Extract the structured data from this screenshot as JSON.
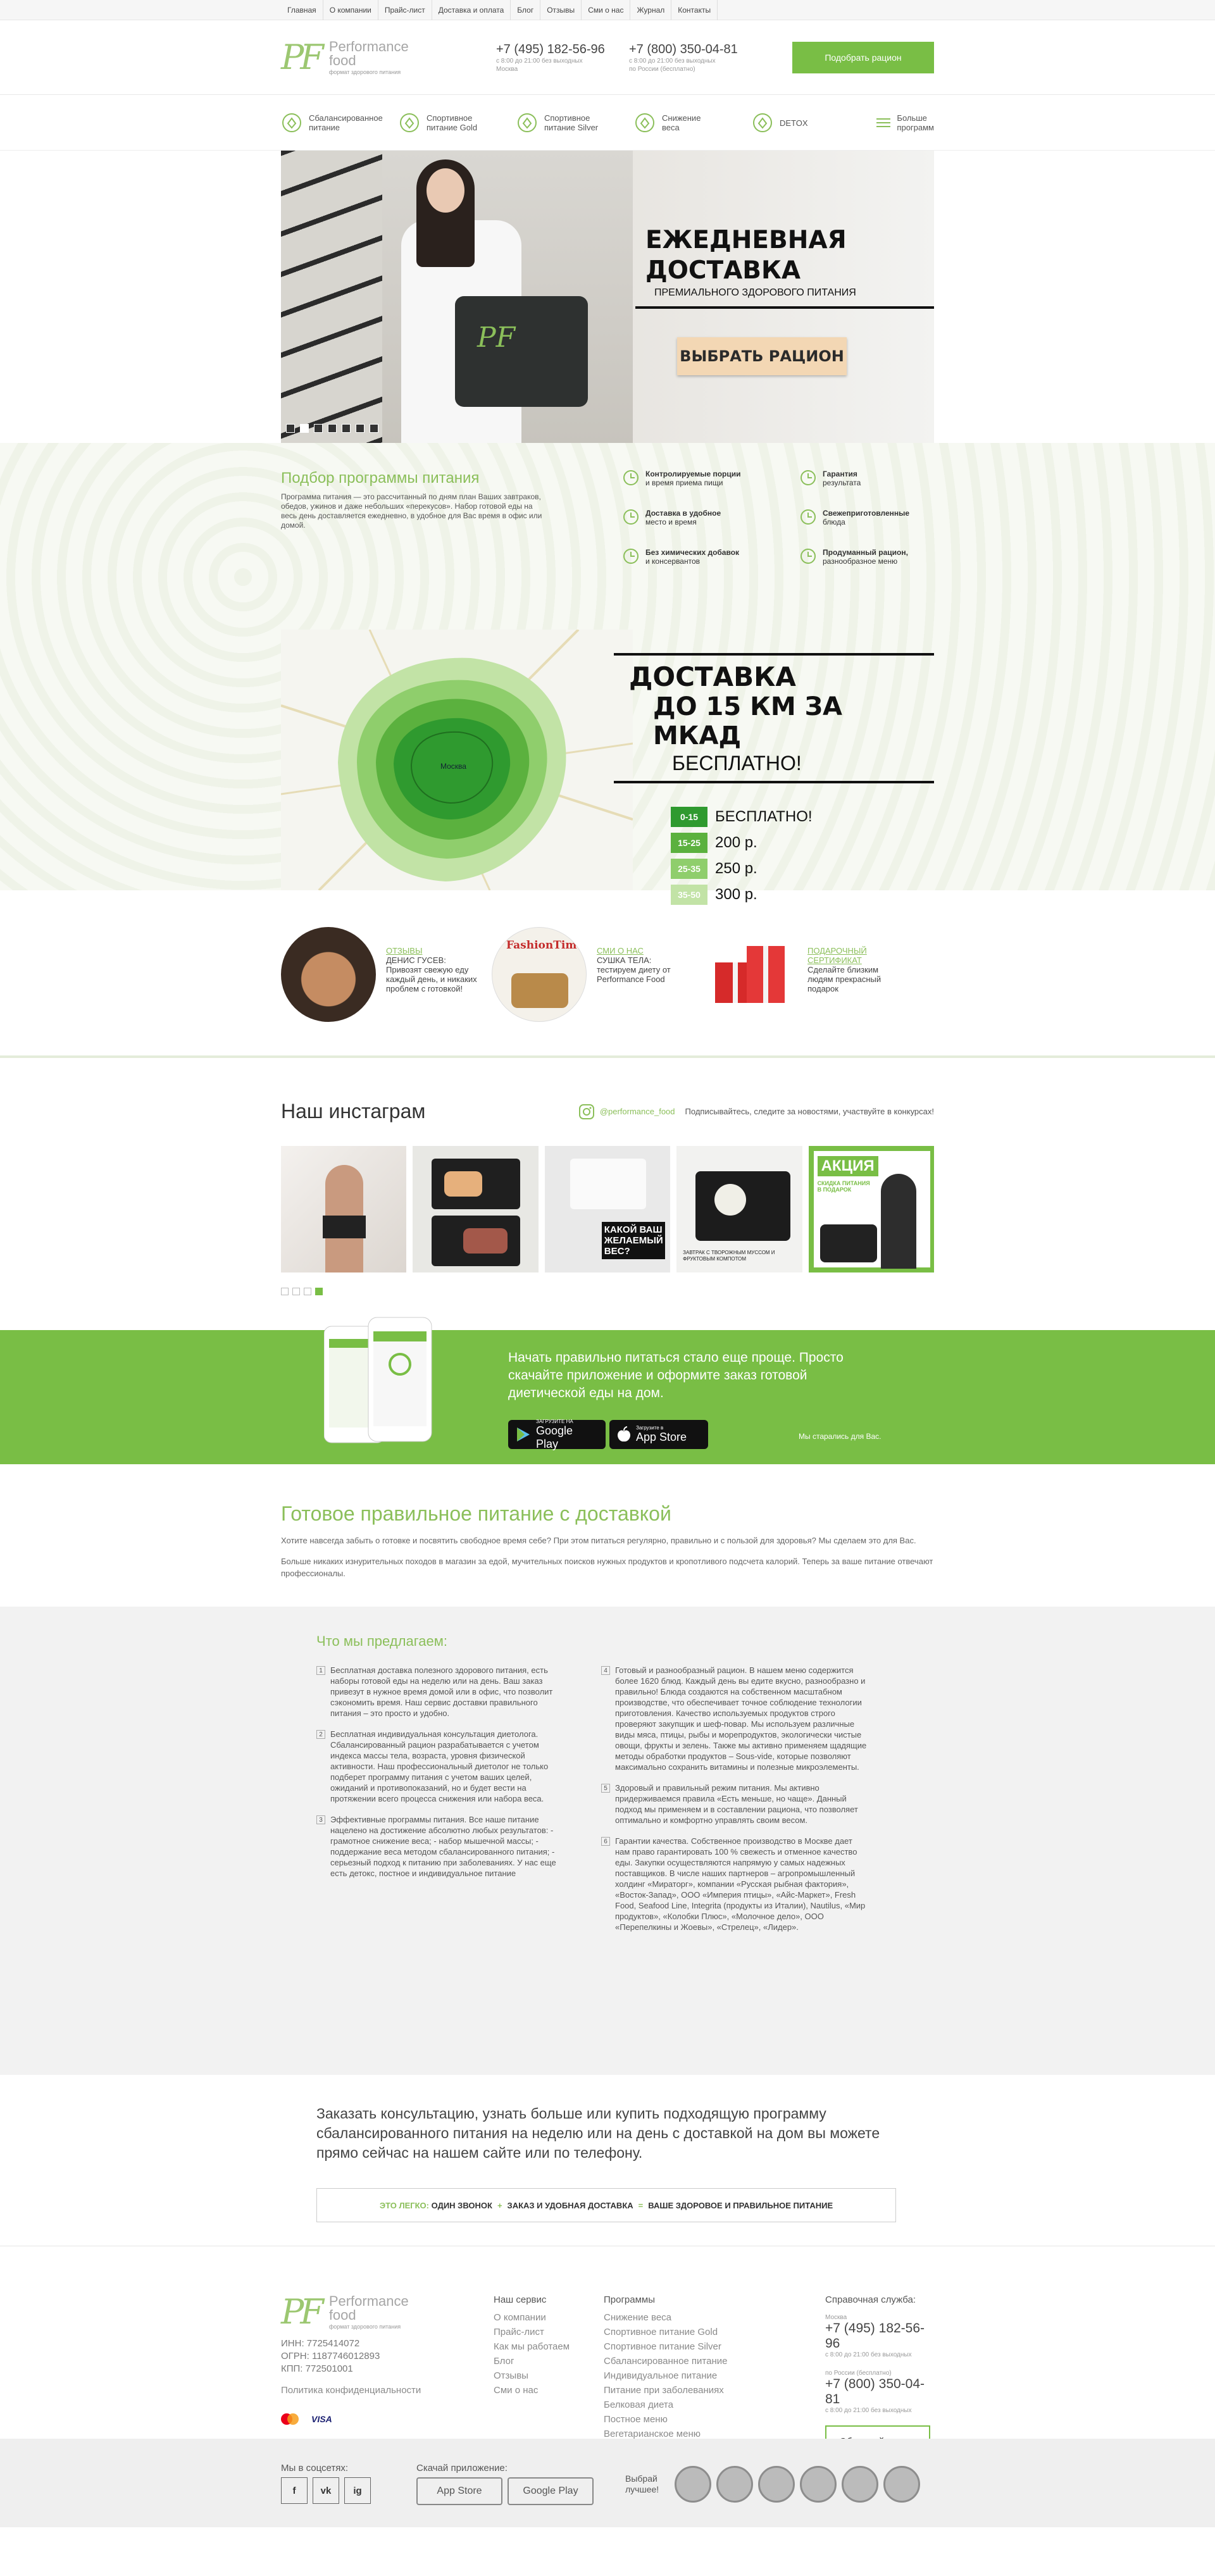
{
  "topnav": [
    "Главная",
    "О компании",
    "Прайс-лист",
    "Доставка и оплата",
    "Блог",
    "Отзывы",
    "Сми о нас",
    "Журнал",
    "Контакты"
  ],
  "header": {
    "logo_mark": "PF",
    "logo_l1": "Performance",
    "logo_l2": "food",
    "logo_sub": "формат здорового питания",
    "phone1": "+7 (495) 182-56-96",
    "phone1_sub1": "с 8:00 до 21:00 без выходных",
    "phone1_sub2": "Москва",
    "phone2": "+7 (800) 350-04-81",
    "phone2_sub1": "с 8:00 до 21:00 без выходных",
    "phone2_sub2": "по России (бесплатно)",
    "cta": "Подобрать рацион"
  },
  "programs": [
    {
      "label1": "Сбалансированное",
      "label2": "питание",
      "icon": "apple-icon"
    },
    {
      "label1": "Спортивное",
      "label2": "питание Gold",
      "icon": "runner-icon"
    },
    {
      "label1": "Спортивное",
      "label2": "питание Silver",
      "icon": "runner-icon"
    },
    {
      "label1": "Снижение",
      "label2": "веса",
      "icon": "scale-icon"
    },
    {
      "label1": "DETOX",
      "label2": "",
      "icon": "glass-icon"
    }
  ],
  "programs_more": {
    "l1": "Больше",
    "l2": "программ"
  },
  "hero": {
    "title1": "ЕЖЕДНЕВНАЯ",
    "title2": "ДОСТАВКА",
    "subtitle": "ПРЕМИАЛЬНОГО ЗДОРОВОГО ПИТАНИЯ",
    "button": "ВЫБРАТЬ РАЦИОН",
    "slide_count": 7,
    "active_slide": 2
  },
  "selection": {
    "title": "Подбор программы питания",
    "desc": "Программа питания — это рассчитанный по дням план Ваших завтраков, обедов, ужинов и даже небольших «перекусов». Набор готовой еды на весь день доставляется ежедневно, в удобное для Вас время в офис или домой.",
    "features": [
      {
        "b": "Контролируемые порции",
        "t": "и время приема пищи"
      },
      {
        "b": "Гарантия",
        "t": "результата"
      },
      {
        "b": "Доставка в удобное",
        "t": "место и время"
      },
      {
        "b": "Свежеприготовленные",
        "t": "блюда"
      },
      {
        "b": "Без химических добавок",
        "t": "и консервантов"
      },
      {
        "b": "Продуманный рацион,",
        "t": "разнообразное меню"
      }
    ]
  },
  "delivery": {
    "t1": "ДОСТАВКА",
    "t2": "ДО 15 КМ ЗА МКАД",
    "t3": "БЕСПЛАТНО!",
    "map_city": "Москва",
    "zones": [
      {
        "range": "0-15",
        "price": "БЕСПЛАТНО!",
        "color": "#2f9a2f"
      },
      {
        "range": "15-25",
        "price": "200 р.",
        "color": "#5bb13e"
      },
      {
        "range": "25-35",
        "price": "250 р.",
        "color": "#8fce6c"
      },
      {
        "range": "35-50",
        "price": "300 р.",
        "color": "#c2e3a6"
      }
    ]
  },
  "reviews": [
    {
      "title": "ОТЗЫВЫ",
      "text": "ДЕНИС ГУСЕВ: Привозят свежую еду каждый день, и никаких проблем с готовкой!"
    },
    {
      "title": "СМИ О НАС",
      "text": "СУШКА ТЕЛА: тестируем диету от Performance Food",
      "brand": "FashionTime"
    },
    {
      "title": "ПОДАРОЧНЫЙ СЕРТИФИКАТ",
      "text": "Сделайте близким людям прекрасный подарок"
    }
  ],
  "instagram": {
    "title": "Наш инстаграм",
    "tag": "@performance_food",
    "tagline": "Подписывайтесь, следите за новостями, участвуйте в конкурсах!",
    "post3_text": "КАКОЙ ВАШ ЖЕЛАЕМЫЙ ВЕС?",
    "post4_text": "ЗАВТРАК С ТВОРОЖНЫМ МУССОМ И ФРУКТОВЫМ КОМПОТОМ",
    "post5_title": "АКЦИЯ",
    "post5_sub": "СКИДКА ПИТАНИЯ В ПОДАРОК",
    "pages": 4,
    "active_page": 4
  },
  "app": {
    "text": "Начать правильно питаться стало еще проще. Просто скачайте приложение и оформите заказ готовой диетической еды на дом.",
    "google_small": "ЗАГРУЗИТЕ НА",
    "google": "Google Play",
    "apple_small": "Загрузите в",
    "apple": "App Store",
    "note": "Мы старались для Вас."
  },
  "seo": {
    "title": "Готовое правильное питание с доставкой",
    "p1": "Хотите навсегда забыть о готовке и посвятить свободное время себе? При этом питаться регулярно, правильно и с пользой для здоровья? Мы сделаем это для Вас.",
    "p2": "Больше никаких изнурительных походов в магазин за едой, мучительных поисков нужных продуктов и кропотливого подсчета калорий. Теперь за ваше питание отвечают профессионалы."
  },
  "offer": {
    "title": "Что мы предлагаем:",
    "left": [
      {
        "n": "1",
        "t": "Бесплатная доставка полезного здорового питания, есть наборы готовой еды на неделю или на день. Ваш заказ привезут в нужное время домой или в офис, что позволит сэкономить время. Наш сервис доставки правильного питания – это просто и удобно."
      },
      {
        "n": "2",
        "t": "Бесплатная индивидуальная консультация диетолога. Сбалансированный рацион разрабатывается с учетом индекса массы тела, возраста, уровня физической активности. Наш профессиональный диетолог не только подберет программу питания с учетом ваших целей, ожиданий и противопоказаний, но и будет вести на протяжении всего процесса снижения или набора веса."
      },
      {
        "n": "3",
        "t": "Эффективные программы питания. Все наше питание нацелено на достижение абсолютно любых результатов: - грамотное снижение веса; - набор мышечной массы; - поддержание веса методом сбалансированного питания; - серьезный подход к питанию при заболеваниях. У нас еще есть детокс, постное и индивидуальное питание"
      }
    ],
    "right": [
      {
        "n": "4",
        "t": "Готовый и разнообразный рацион. В нашем меню содержится более 1620 блюд. Каждый день вы едите вкусно, разнообразно и правильно! Блюда создаются на собственном масштабном производстве, что обеспечивает точное соблюдение технологии приготовления. Качество используемых продуктов строго проверяют закупщик и шеф-повар. Мы используем различные виды мяса, птицы, рыбы и морепродуктов, экологически чистые овощи, фрукты и зелень. Также мы активно применяем щадящие методы обработки продуктов – Sous-vide, которые позволяют максимально сохранить витамины и полезные микроэлементы."
      },
      {
        "n": "5",
        "t": "Здоровый и правильный режим питания. Мы активно придерживаемся правила «Есть меньше, но чаще». Данный подход мы применяем и в составлении рациона, что позволяет оптимально и комфортно управлять своим весом."
      },
      {
        "n": "6",
        "t": "Гарантии качества. Собственное производство в Москве дает нам право гарантировать 100 % свежесть и отменное качество еды. Закупки осуществляются напрямую у самых надежных поставщиков. В числе наших партнеров – агропромышленный холдинг «Мираторг», компании «Русская рыбная фактория», «Восток-Запад», ООО «Империя птицы», «Айс-Маркет», Fresh Food, Seafood Line, Integrita (продукты из Италии), Nautilus, «Мир продуктов», «Колобки Плюс», «Молочное дело», ООО «Перепелкины и Жоевы», «Стрелец», «Лидер»."
      }
    ]
  },
  "cta": {
    "text": "Заказать консультацию, узнать больше или купить подходящую программу сбалансированного питания на неделю или на день с доставкой на дом вы можете прямо сейчас на нашем сайте или по телефону.",
    "easy_lead": "ЭТО ЛЕГКО:",
    "step1": "ОДИН ЗВОНОК",
    "step2": "ЗАКАЗ И УДОБНАЯ ДОСТАВКА",
    "step3": "ВАШЕ ЗДОРОВОЕ И ПРАВИЛЬНОЕ ПИТАНИЕ",
    "sep": "+",
    "eq": "="
  },
  "footer": {
    "inn": "ИНН: 7725414072",
    "ogrn": "ОГРН: 1187746012893",
    "kpp": "КПП: 772501001",
    "privacy": "Политика конфиденциальности",
    "service_title": "Наш сервис",
    "service": [
      "О компании",
      "Прайс-лист",
      "Как мы работаем",
      "Блог",
      "Отзывы",
      "Сми о нас"
    ],
    "programs_title": "Программы",
    "programs": [
      "Снижение веса",
      "Спортивное питание Gold",
      "Спортивное питание Silver",
      "Сбалансированное питание",
      "Индивидуальное питание",
      "Питание при заболеваниях",
      "Белковая диета",
      "Постное меню",
      "Вегетарианское меню"
    ],
    "help_title": "Справочная служба:",
    "moscow": "Москва",
    "phone1": "+7 (495) 182-56-96",
    "phone1_sub": "с 8:00 до 21:00 без выходных",
    "russia": "по России (бесплатно)",
    "phone2": "+7 (800) 350-04-81",
    "phone2_sub": "с 8:00 до 21:00 без выходных",
    "callback": "Обратный звонок",
    "card1": "MasterCard",
    "card2": "VISA",
    "social_title": "Мы в соцсетях:",
    "social": [
      "f",
      "vk",
      "ig"
    ],
    "download_title": "Скачай приложение:",
    "app_store": "App Store",
    "google_play": "Google Play",
    "best": "Выбрай лучшее!"
  }
}
